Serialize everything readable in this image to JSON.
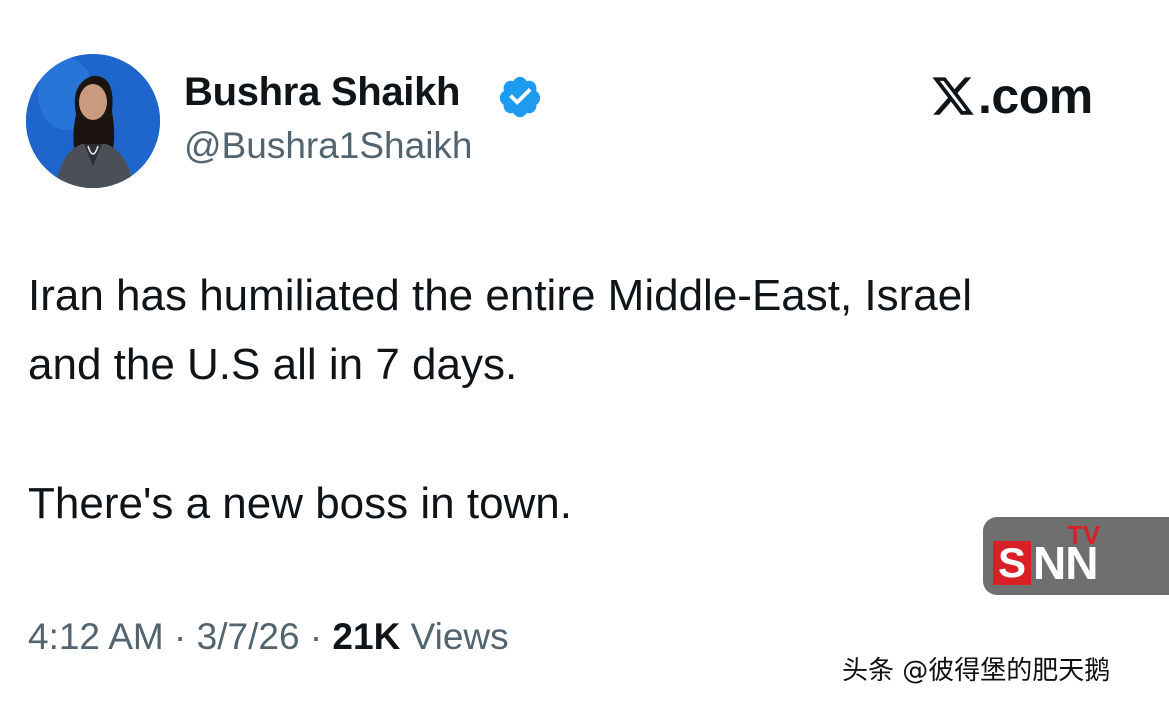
{
  "author": {
    "name": "Bushra Shaikh",
    "handle": "@Bushra1Shaikh",
    "verified": true,
    "badge_color": "#1d9bf0"
  },
  "brand": {
    "text": ".com",
    "icon": "x-logo-icon"
  },
  "tweet": {
    "lines": [
      "Iran has humiliated the entire Middle-East, Israel",
      "and the U.S all in 7 days.",
      "There's a new boss in town."
    ]
  },
  "meta": {
    "time": "4:12 AM",
    "separator": "·",
    "date": "3/7/26",
    "views_count": "21K",
    "views_label": "Views"
  },
  "overlay": {
    "logo_s": "S",
    "logo_nn": "NN",
    "logo_tv": "TV",
    "watermark": "头条 @彼得堡的肥天鹅"
  },
  "colors": {
    "text_primary": "#0f1419",
    "text_secondary": "#536471",
    "snn_red": "#d92027",
    "snn_gray": "#6f6f6f"
  }
}
